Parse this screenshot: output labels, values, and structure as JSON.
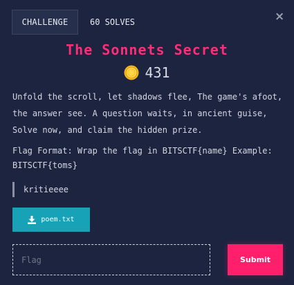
{
  "tabs": {
    "challenge_label": "CHALLENGE",
    "solves_label": "60 SOLVES"
  },
  "close_icon": "×",
  "challenge": {
    "title": "The Sonnets Secret",
    "points": "431",
    "description": "Unfold the scroll, let shadows flee, The game's afoot, the answer see. A question waits, in ancient guise, Solve now, and claim the hidden prize.",
    "flag_format": "Flag Format: Wrap the flag in BITSCTF{name} Example: BITSCTF{toms}",
    "author": "kritieeee",
    "file_label": "poem.txt"
  },
  "form": {
    "flag_placeholder": "Flag",
    "flag_value": "",
    "submit_label": "Submit"
  },
  "colors": {
    "background": "#1c2440",
    "title": "#ff2d78",
    "download_button": "#17a2b8",
    "submit_button": "#ff1f6a",
    "coin": "#f5b921"
  },
  "icons": {
    "points": "coin-icon",
    "download": "download-icon",
    "close": "close-icon"
  }
}
